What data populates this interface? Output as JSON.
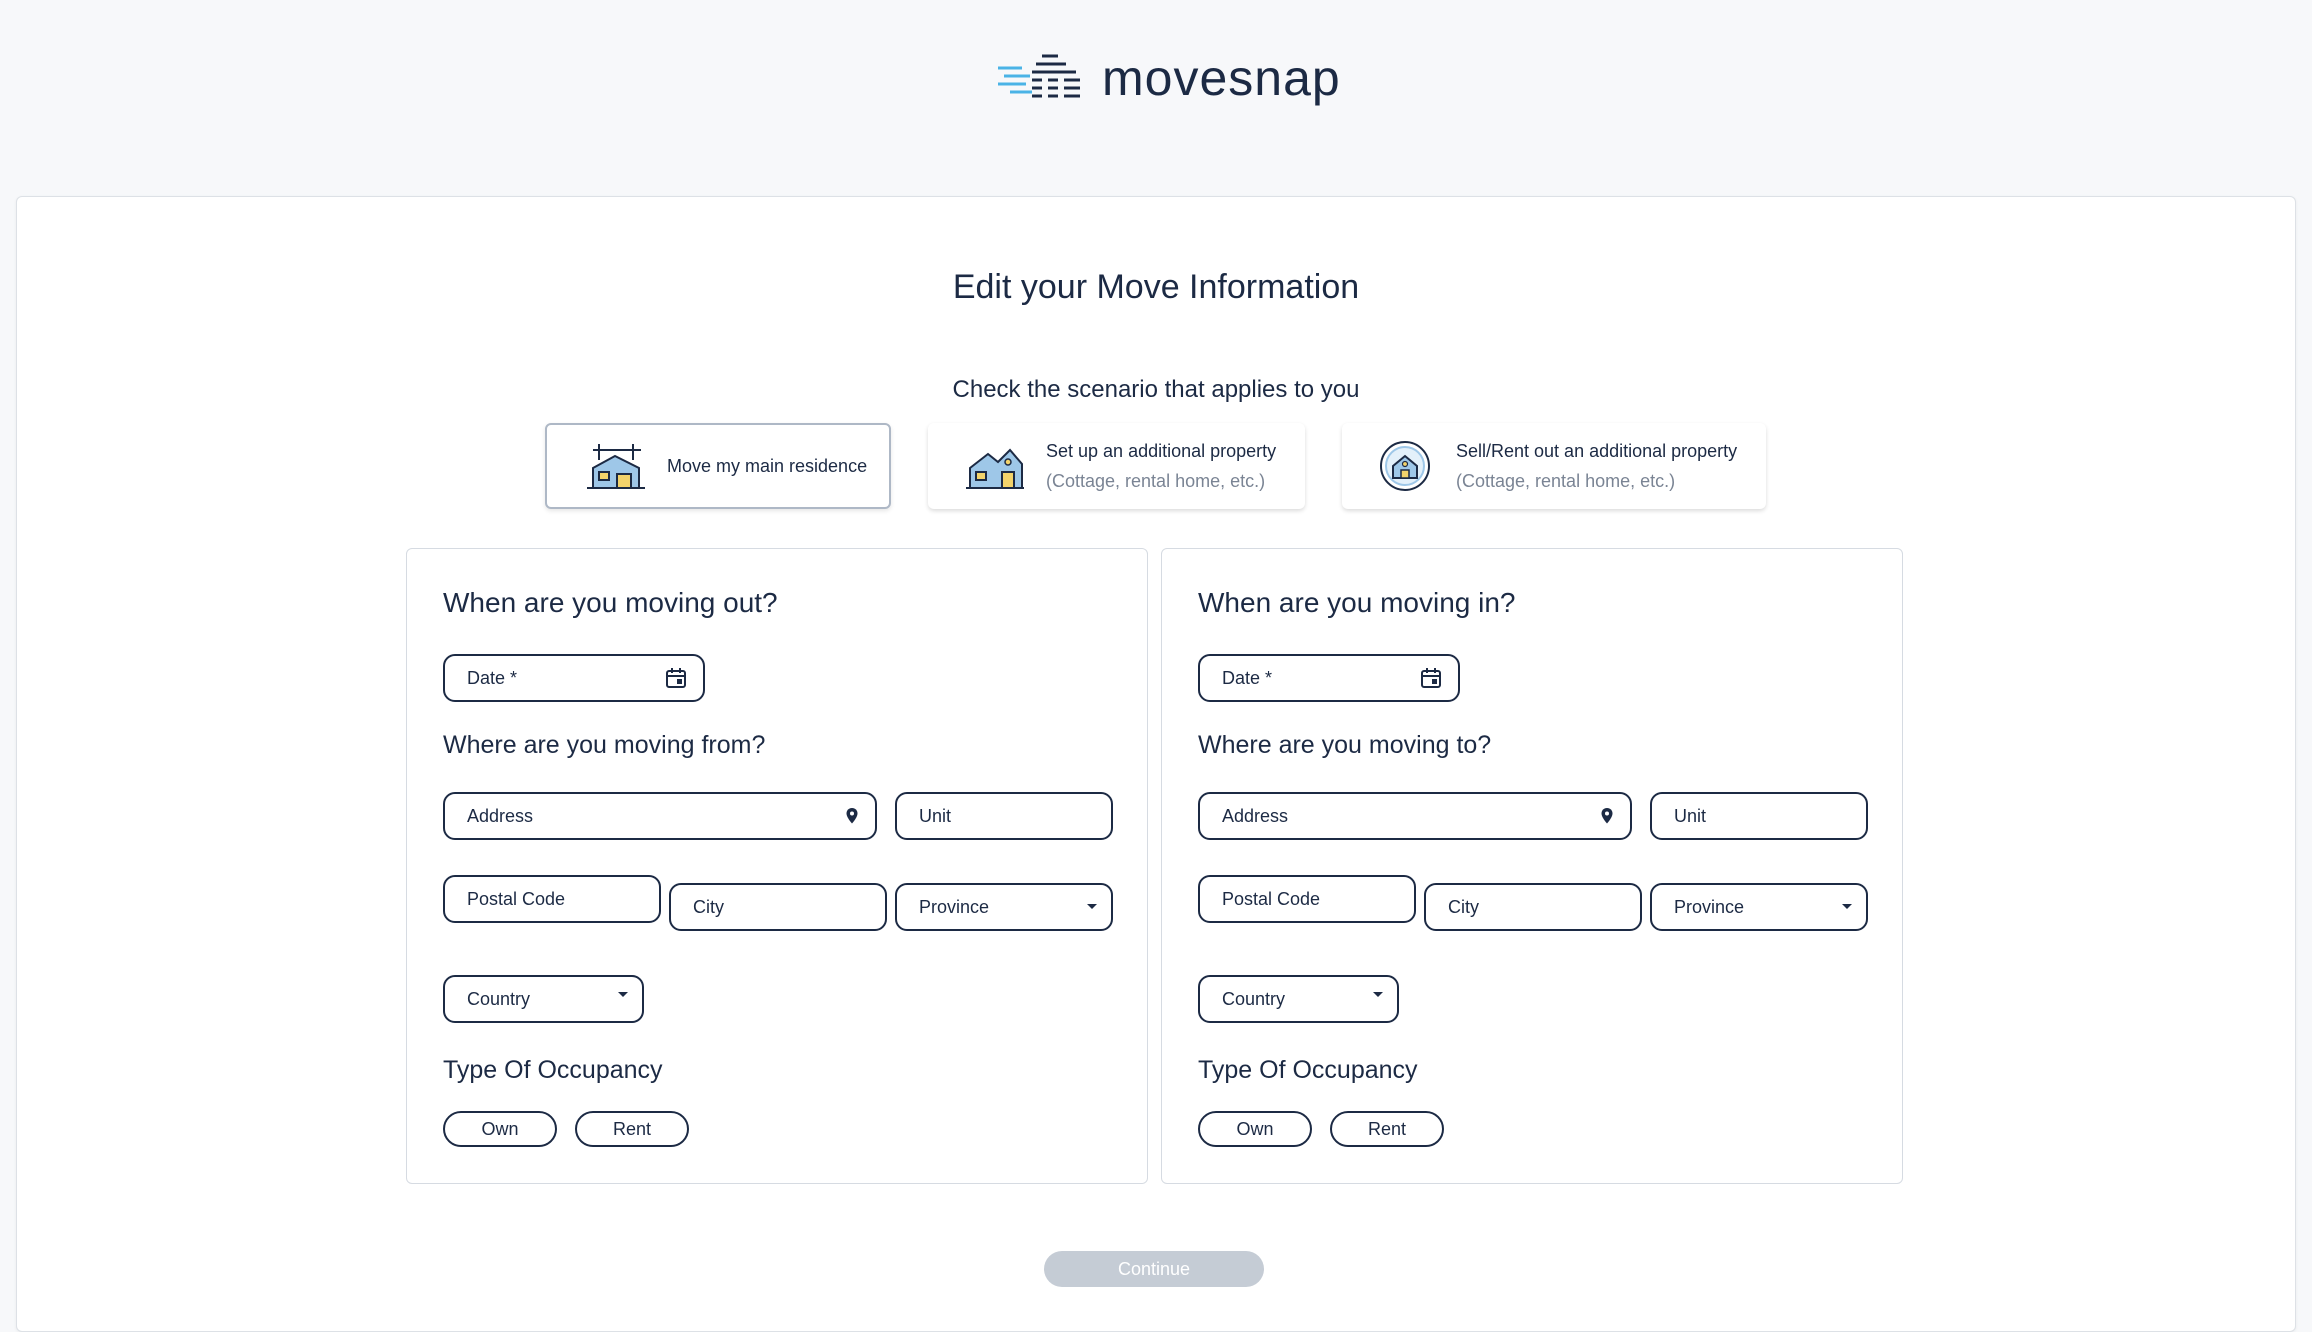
{
  "brand": {
    "name": "movesnap",
    "accent": "#4ab3e6",
    "dark": "#1c2a44"
  },
  "page": {
    "title": "Edit your Move Information",
    "subtitle": "Check the scenario that applies to you"
  },
  "scenarios": [
    {
      "icon": "house-moving-icon",
      "title": "Move my main residence",
      "subtitle": "",
      "selected": true
    },
    {
      "icon": "cottage-icon",
      "title": "Set up an additional property",
      "subtitle": "(Cottage, rental home, etc.)",
      "selected": false
    },
    {
      "icon": "house-badge-icon",
      "title": "Sell/Rent out an additional property",
      "subtitle": "(Cottage, rental home, etc.)",
      "selected": false
    }
  ],
  "moving_out": {
    "heading": "When are you moving out?",
    "date_label": "Date *",
    "where_heading": "Where are you moving from?",
    "address_placeholder": "Address",
    "unit_placeholder": "Unit",
    "postal_placeholder": "Postal Code",
    "city_placeholder": "City",
    "province_placeholder": "Province",
    "country_placeholder": "Country",
    "occupancy_heading": "Type Of Occupancy",
    "own_label": "Own",
    "rent_label": "Rent"
  },
  "moving_in": {
    "heading": "When are you moving in?",
    "date_label": "Date *",
    "where_heading": "Where are you moving to?",
    "address_placeholder": "Address",
    "unit_placeholder": "Unit",
    "postal_placeholder": "Postal Code",
    "city_placeholder": "City",
    "province_placeholder": "Province",
    "country_placeholder": "Country",
    "occupancy_heading": "Type Of Occupancy",
    "own_label": "Own",
    "rent_label": "Rent"
  },
  "actions": {
    "continue_label": "Continue",
    "continue_enabled": false
  }
}
